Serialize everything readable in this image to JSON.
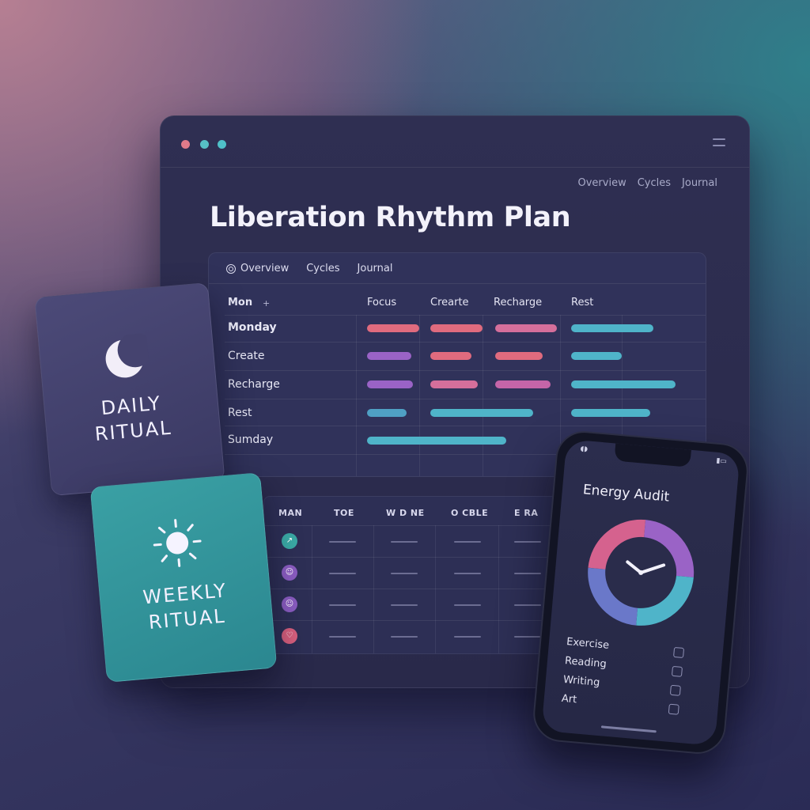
{
  "window": {
    "dot_colors": [
      "#e07b8a",
      "#57c0c6",
      "#4fc0c8"
    ],
    "top_nav": [
      "Overview",
      "Cycles",
      "Journal"
    ],
    "title": "Liberation Rhythm Plan"
  },
  "planner": {
    "tabs": [
      "Overview",
      "Cycles",
      "Journal"
    ],
    "header": {
      "first": "Mon",
      "plus": "+",
      "columns": [
        "Focus",
        "Crearte",
        "Recharge",
        "Rest"
      ]
    },
    "rows": [
      {
        "label": "Monday"
      },
      {
        "label": "Create"
      },
      {
        "label": "Recharge"
      },
      {
        "label": "Rest"
      },
      {
        "label": "Sumday"
      }
    ]
  },
  "grid2": {
    "headers": [
      "MAN",
      "TOE",
      "W D NE",
      "O CBLE",
      "E RA"
    ],
    "icon_colors": [
      "#3aa8a4",
      "#8a5cc0",
      "#8a5cc0",
      "#d9607e"
    ]
  },
  "cards": {
    "daily": {
      "line1": "DAILY",
      "line2": "RITUAL",
      "icon": "moon-icon"
    },
    "weekly": {
      "line1": "WEEKLY",
      "line2": "RITUAL",
      "icon": "sun-icon"
    }
  },
  "phone": {
    "title": "Energy Audit",
    "checklist": [
      "Exercise",
      "Reading",
      "Writing",
      "Art"
    ]
  },
  "colors": {
    "red": "#e06b7e",
    "pink": "#d56f9b",
    "purple": "#9a63c6",
    "teal": "#4fb4c9"
  }
}
